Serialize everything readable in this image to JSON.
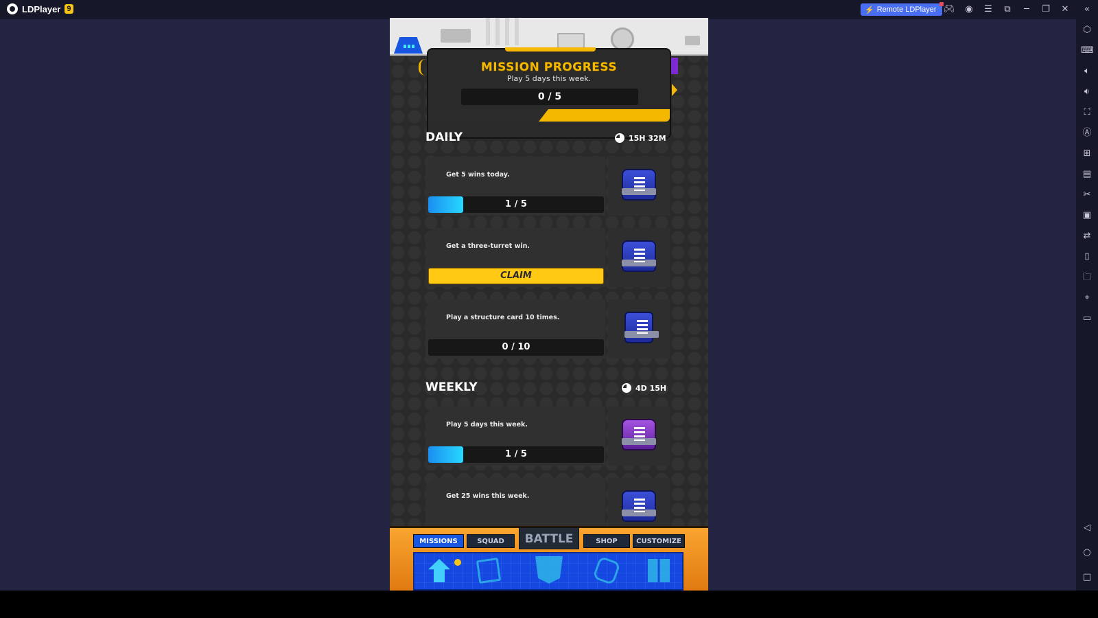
{
  "window": {
    "app_name": "LDPlayer",
    "version_badge": "9",
    "remote_button_label": "Remote LDPlayer",
    "titlebar_icons": [
      "gamepad-icon",
      "account-icon",
      "menu-icon",
      "screenshot-icon",
      "minimize-icon",
      "restore-icon",
      "close-icon",
      "collapse-sidebar-icon"
    ]
  },
  "sidebar": {
    "icons": [
      "settings-icon",
      "keyboard-icon",
      "volume-up-icon",
      "volume-down-icon",
      "fullscreen-icon",
      "auto-rotate-icon",
      "add-instance-icon",
      "apk-install-icon",
      "scissors-icon",
      "video-record-icon",
      "sync-icon",
      "shake-icon",
      "folder-icon",
      "location-icon",
      "rotate-screen-icon"
    ],
    "nav_icons": [
      "back-icon",
      "home-icon",
      "recents-icon"
    ]
  },
  "game": {
    "mission_progress": {
      "title": "MISSION PROGRESS",
      "subtitle": "Play 5 days this week.",
      "progress_text": "0 / 5",
      "current": 0,
      "total": 5
    },
    "daily": {
      "title": "DAILY",
      "timer": "15H 32M",
      "missions": [
        {
          "text": "Get 5 wins today.",
          "progress_text": "1 / 5",
          "current": 1,
          "total": 5,
          "state": "progress",
          "reward": "blue-chest"
        },
        {
          "text": "Get a three-turret win.",
          "claim_label": "CLAIM",
          "state": "claim",
          "reward": "blue-chest"
        },
        {
          "text": "Play a structure card 10 times.",
          "progress_text": "0 / 10",
          "current": 0,
          "total": 10,
          "state": "progress",
          "reward": "blue-crate"
        }
      ]
    },
    "weekly": {
      "title": "WEEKLY",
      "timer": "4D 15H",
      "missions": [
        {
          "text": "Play 5 days this week.",
          "progress_text": "1 / 5",
          "current": 1,
          "total": 5,
          "state": "progress",
          "reward": "purple-chest"
        },
        {
          "text": "Get 25 wins this week.",
          "state": "partial",
          "reward": "blue-chest"
        }
      ]
    },
    "nav": {
      "tabs": [
        "MISSIONS",
        "SQUAD",
        "BATTLE",
        "SHOP",
        "CUSTOMIZE"
      ],
      "active": "MISSIONS"
    },
    "colors": {
      "accent": "#f5b800",
      "progress": "#1a8ef0",
      "claim": "#ffc914",
      "nav_active": "#1656e0"
    }
  }
}
